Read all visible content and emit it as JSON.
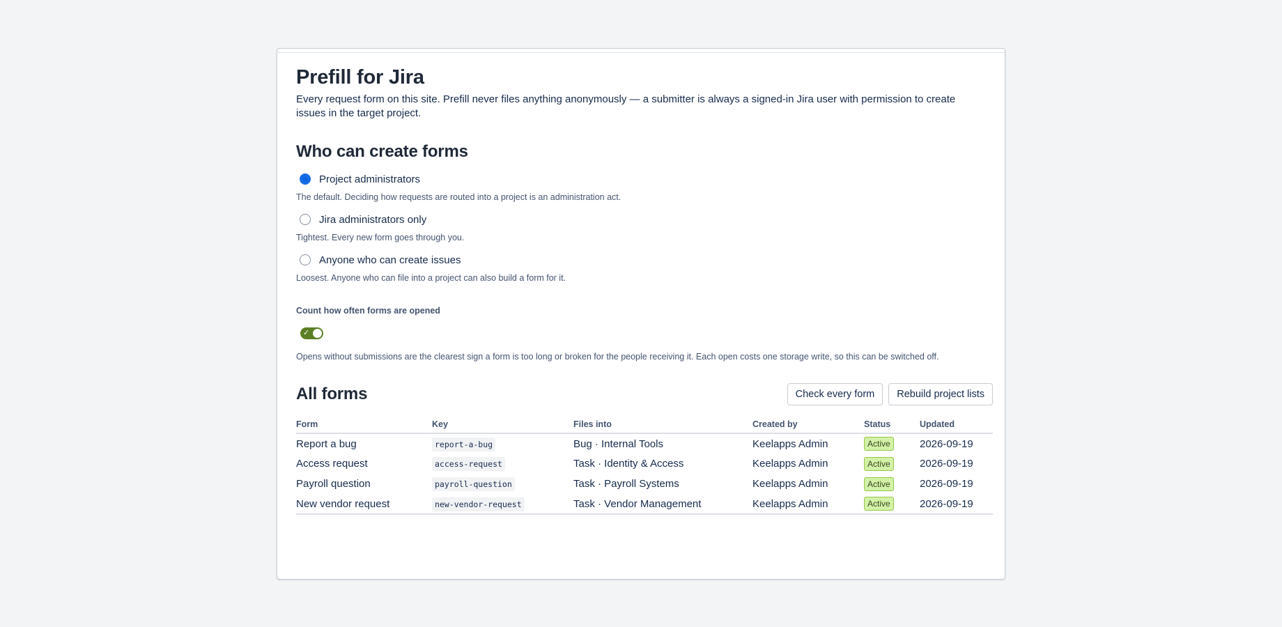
{
  "page": {
    "title": "Prefill for Jira",
    "intro": "Every request form on this site. Prefill never files anything anonymously — a submitter is always a signed-in Jira user with permission to create issues in the target project."
  },
  "who_can_create": {
    "heading": "Who can create forms",
    "options": [
      {
        "label": "Project administrators",
        "help": "The default. Deciding how requests are routed into a project is an administration act.",
        "selected": true
      },
      {
        "label": "Jira administrators only",
        "help": "Tightest. Every new form goes through you.",
        "selected": false
      },
      {
        "label": "Anyone who can create issues",
        "help": "Loosest. Anyone who can file into a project can also build a form for it.",
        "selected": false
      }
    ]
  },
  "open_count": {
    "label": "Count how often forms are opened",
    "enabled": true,
    "toggle_icon": "check-icon",
    "help": "Opens without submissions are the clearest sign a form is too long or broken for the people receiving it. Each open costs one storage write, so this can be switched off."
  },
  "all_forms": {
    "heading": "All forms",
    "check_button": "Check every form",
    "rebuild_button": "Rebuild project lists",
    "columns": [
      "Form",
      "Key",
      "Files into",
      "Created by",
      "Status",
      "Updated"
    ],
    "rows": [
      {
        "form": "Report a bug",
        "key": "report-a-bug",
        "files_into": "Bug · Internal Tools",
        "created_by": "Keelapps Admin",
        "status": "Active",
        "updated": "2026-09-19"
      },
      {
        "form": "Access request",
        "key": "access-request",
        "files_into": "Task · Identity & Access",
        "created_by": "Keelapps Admin",
        "status": "Active",
        "updated": "2026-09-19"
      },
      {
        "form": "Payroll question",
        "key": "payroll-question",
        "files_into": "Task · Payroll Systems",
        "created_by": "Keelapps Admin",
        "status": "Active",
        "updated": "2026-09-19"
      },
      {
        "form": "New vendor request",
        "key": "new-vendor-request",
        "files_into": "Task · Vendor Management",
        "created_by": "Keelapps Admin",
        "status": "Active",
        "updated": "2026-09-19"
      }
    ]
  },
  "colors": {
    "radio_selected": "#0c66e4",
    "toggle_on": "#5b7f24",
    "badge_active_bg": "#d3f1a7"
  }
}
